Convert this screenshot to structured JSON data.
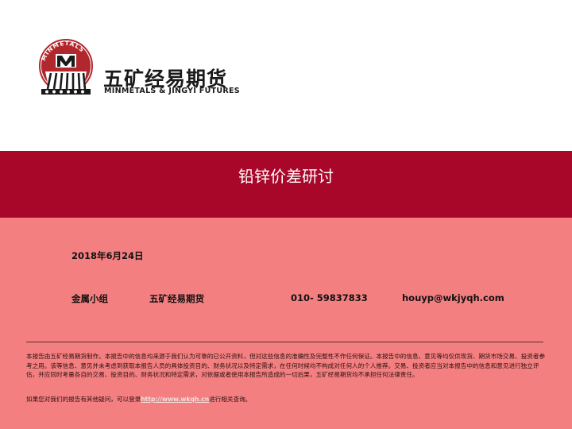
{
  "header": {
    "logo": {
      "emblem_text": "MINMETALS",
      "name_cn": "五矿经易期货",
      "name_en": "MINMETALS & JINGYI FUTURES",
      "colors": {
        "emblem_red": "#b0282d",
        "emblem_dark": "#1a1a1a"
      }
    }
  },
  "title": "铅锌价差研讨",
  "date": "2018年6月24日",
  "contact": {
    "team": "金属小组",
    "company": "五矿经易期货",
    "phone": "010- 59837833",
    "email": "houyp@wkjyqh.com"
  },
  "disclaimer": "本报告由五矿经易期货制作。本报告中的信息均来源于我们认为可靠的已公开资料，但对这些信息的准确性及完整性不作任何保证。本报告中的信息、意见等均仅供现货、期货市场交易、投资者参考之用。该等信息、意见并未考虑到获取本报告人员的具体投资目的、财务状况以及特定需求，在任何时候均不构成对任何人的个人推荐。交易、投资者应当对本报告中的信息和意见进行独立评估，并应同时考量各自的交易、投资目的、财务状况和特定需求，对依据或者使用本报告所造成的一切后果，五矿经易期货均不承担任何法律责任。",
  "contact_note": {
    "prefix": "如果您对我们的报告有其他疑问，可以登录",
    "link": "http://www.wkqh.cn",
    "suffix": "进行相关查询。"
  },
  "colors": {
    "title_band": "#a8072a",
    "body_background": "#f47f80",
    "header_background": "#ffffff"
  }
}
